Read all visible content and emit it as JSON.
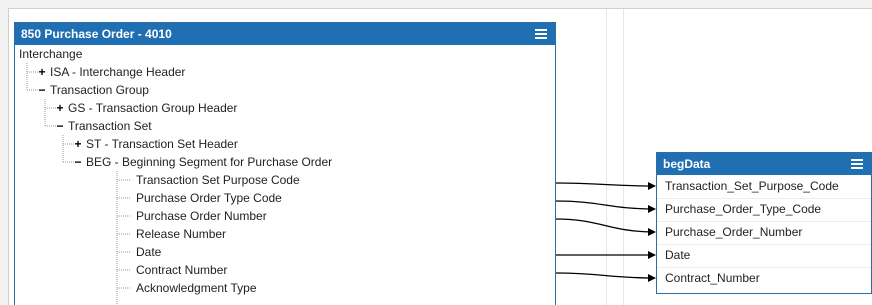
{
  "left_panel": {
    "title": "850 Purchase Order - 4010",
    "tree": [
      {
        "label": "Interchange",
        "toggle": ""
      },
      {
        "label": "ISA - Interchange Header",
        "toggle": "+"
      },
      {
        "label": "Transaction Group",
        "toggle": "−"
      },
      {
        "label": "GS - Transaction Group Header",
        "toggle": "+"
      },
      {
        "label": "Transaction Set",
        "toggle": "−"
      },
      {
        "label": "ST - Transaction Set Header",
        "toggle": "+"
      },
      {
        "label": "BEG - Beginning Segment for Purchase Order",
        "toggle": "−"
      },
      {
        "label": "Transaction Set Purpose Code",
        "toggle": ""
      },
      {
        "label": "Purchase Order Type Code",
        "toggle": ""
      },
      {
        "label": "Purchase Order Number",
        "toggle": ""
      },
      {
        "label": "Release Number",
        "toggle": ""
      },
      {
        "label": "Date",
        "toggle": ""
      },
      {
        "label": "Contract Number",
        "toggle": ""
      },
      {
        "label": "Acknowledgment Type",
        "toggle": ""
      }
    ]
  },
  "right_panel": {
    "title": "begData",
    "fields": [
      "Transaction_Set_Purpose_Code",
      "Purchase_Order_Type_Code",
      "Purchase_Order_Number",
      "Date",
      "Contract_Number"
    ]
  },
  "colors": {
    "header": "#1f6fb2",
    "connector": "#000000"
  }
}
